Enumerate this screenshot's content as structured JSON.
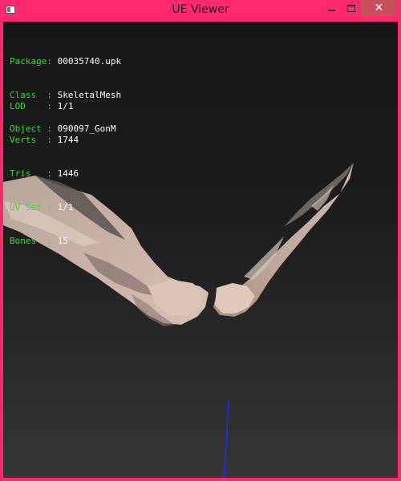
{
  "window": {
    "title": "UE Viewer",
    "close_glyph": "✕"
  },
  "info": {
    "object_rows": [
      {
        "label": "Package:",
        "value": "00035740.upk"
      },
      {
        "label": "Class  :",
        "value": "SkeletalMesh"
      },
      {
        "label": "Object :",
        "value": "090097_GonM"
      }
    ],
    "stats_rows": [
      {
        "label": "LOD    :",
        "value": "1/1"
      },
      {
        "label": "Verts  :",
        "value": "1744"
      },
      {
        "label": "Tris   :",
        "value": "1446"
      },
      {
        "label": "UV Set :",
        "value": "1/1"
      },
      {
        "label": "Bones  :",
        "value": "15"
      }
    ]
  },
  "colors": {
    "frame": "#ff2a6d",
    "label_text": "#33dd33",
    "value_text": "#ffffff",
    "axis_line": "#1a2cff"
  },
  "icons": {
    "app": "app-window-icon",
    "minimize": "minimize-icon",
    "maximize": "maximize-icon",
    "close": "close-icon"
  }
}
